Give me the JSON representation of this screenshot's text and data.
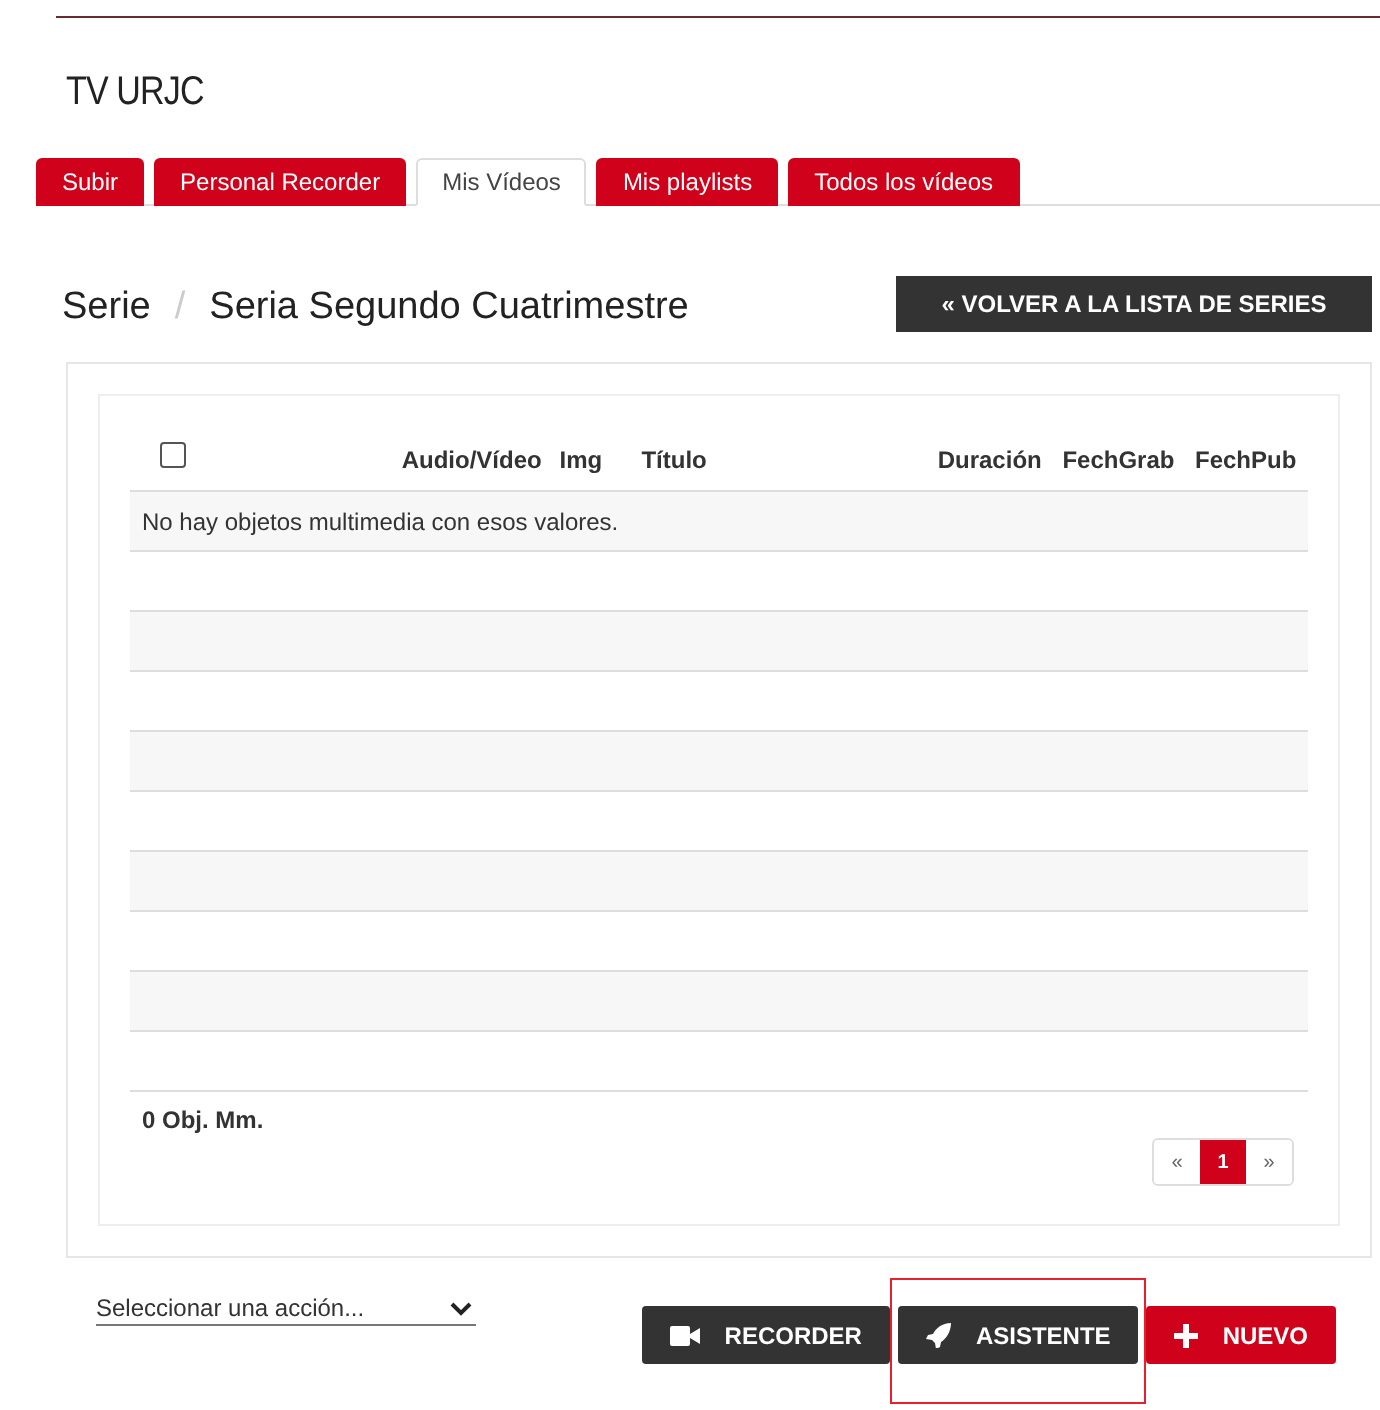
{
  "site_title": "TV URJC",
  "tabs": [
    {
      "label": "Subir",
      "selected": false
    },
    {
      "label": "Personal Recorder",
      "selected": false
    },
    {
      "label": "Mis Vídeos",
      "selected": true
    },
    {
      "label": "Mis playlists",
      "selected": false
    },
    {
      "label": "Todos los vídeos",
      "selected": false
    }
  ],
  "breadcrumb": {
    "section": "Serie",
    "separator": "/",
    "current": "Seria Segundo Cuatrimestre"
  },
  "back_button": "« VOLVER A LA LISTA DE SERIES",
  "table": {
    "select_all_checked": false,
    "columns": [
      "Audio/Vídeo",
      "Img",
      "Título",
      "Duración",
      "FechGrab",
      "FechPub"
    ],
    "empty_message": "No hay objetos multimedia con esos valores.",
    "count": "0 Obj. Mm.",
    "pagination": [
      {
        "label": "«",
        "selected": false
      },
      {
        "label": "1",
        "selected": true
      },
      {
        "label": "»",
        "selected": false
      }
    ]
  },
  "action_select": {
    "value": "Seleccionar una acción..."
  },
  "buttons": [
    {
      "kind": "recorder",
      "label": "RECORDER",
      "highlighted": false
    },
    {
      "kind": "wizard",
      "label": "ASISTENTE",
      "highlighted": true
    },
    {
      "kind": "new",
      "label": "NUEVO",
      "highlighted": false
    }
  ]
}
